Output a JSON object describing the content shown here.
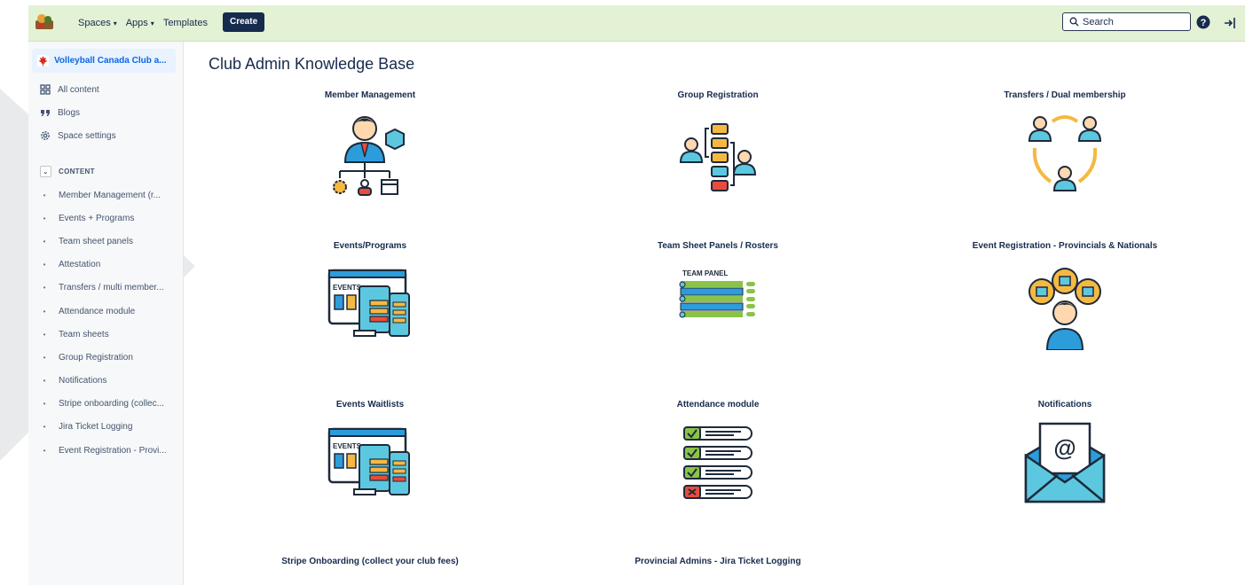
{
  "topbar": {
    "nav": [
      {
        "label": "Spaces",
        "chevron": "▾"
      },
      {
        "label": "Apps",
        "chevron": "▾"
      },
      {
        "label": "Templates",
        "chevron": ""
      }
    ],
    "create_label": "Create",
    "search_placeholder": "Search",
    "icons": [
      "space-logo-icon",
      "search-icon",
      "help-icon",
      "logout-icon"
    ]
  },
  "sidebar": {
    "space_name": "Volleyball Canada Club a...",
    "links": [
      {
        "label": "All content",
        "icon": "grid-icon"
      },
      {
        "label": "Blogs",
        "icon": "quote-icon"
      },
      {
        "label": "Space settings",
        "icon": "gear-icon"
      }
    ],
    "content_header": "CONTENT",
    "tree": [
      "Member Management (r...",
      "Events + Programs",
      "Team sheet panels",
      "Attestation",
      "Transfers / multi member...",
      "Attendance module",
      "Team sheets",
      "Group Registration",
      "Notifications",
      "Stripe onboarding (collec...",
      "Jira Ticket Logging",
      "Event Registration - Provi..."
    ]
  },
  "main": {
    "title": "Club Admin Knowledge Base",
    "cards": [
      {
        "title": "Member Management",
        "icon": "member-management-icon"
      },
      {
        "title": "Group Registration",
        "icon": "group-registration-icon"
      },
      {
        "title": "Transfers / Dual membership",
        "icon": "transfers-icon"
      },
      {
        "title": "Events/Programs",
        "icon": "events-programs-icon",
        "label": "EVENTS"
      },
      {
        "title": "Team Sheet Panels / Rosters",
        "icon": "team-panel-icon",
        "label": "TEAM PANEL"
      },
      {
        "title": "Event Registration - Provincials & Nationals",
        "icon": "event-registration-icon"
      },
      {
        "title": "Events Waitlists",
        "icon": "events-waitlists-icon",
        "label": "EVENTS"
      },
      {
        "title": "Attendance module",
        "icon": "attendance-checklist-icon"
      },
      {
        "title": "Notifications",
        "icon": "email-envelope-icon",
        "label": "@"
      },
      {
        "title": "Stripe Onboarding (collect your club fees)",
        "icon": ""
      },
      {
        "title": "Provincial Admins - Jira Ticket Logging",
        "icon": ""
      }
    ]
  },
  "colors": {
    "topbar_bg": "#e3f1d5",
    "create_bg": "#172b4d",
    "sidebar_bg": "#f7f8f9",
    "selected_bg": "#e9f2ff",
    "accent_blue": "#0c66e4",
    "icon_dark": "#1e2a3a"
  }
}
